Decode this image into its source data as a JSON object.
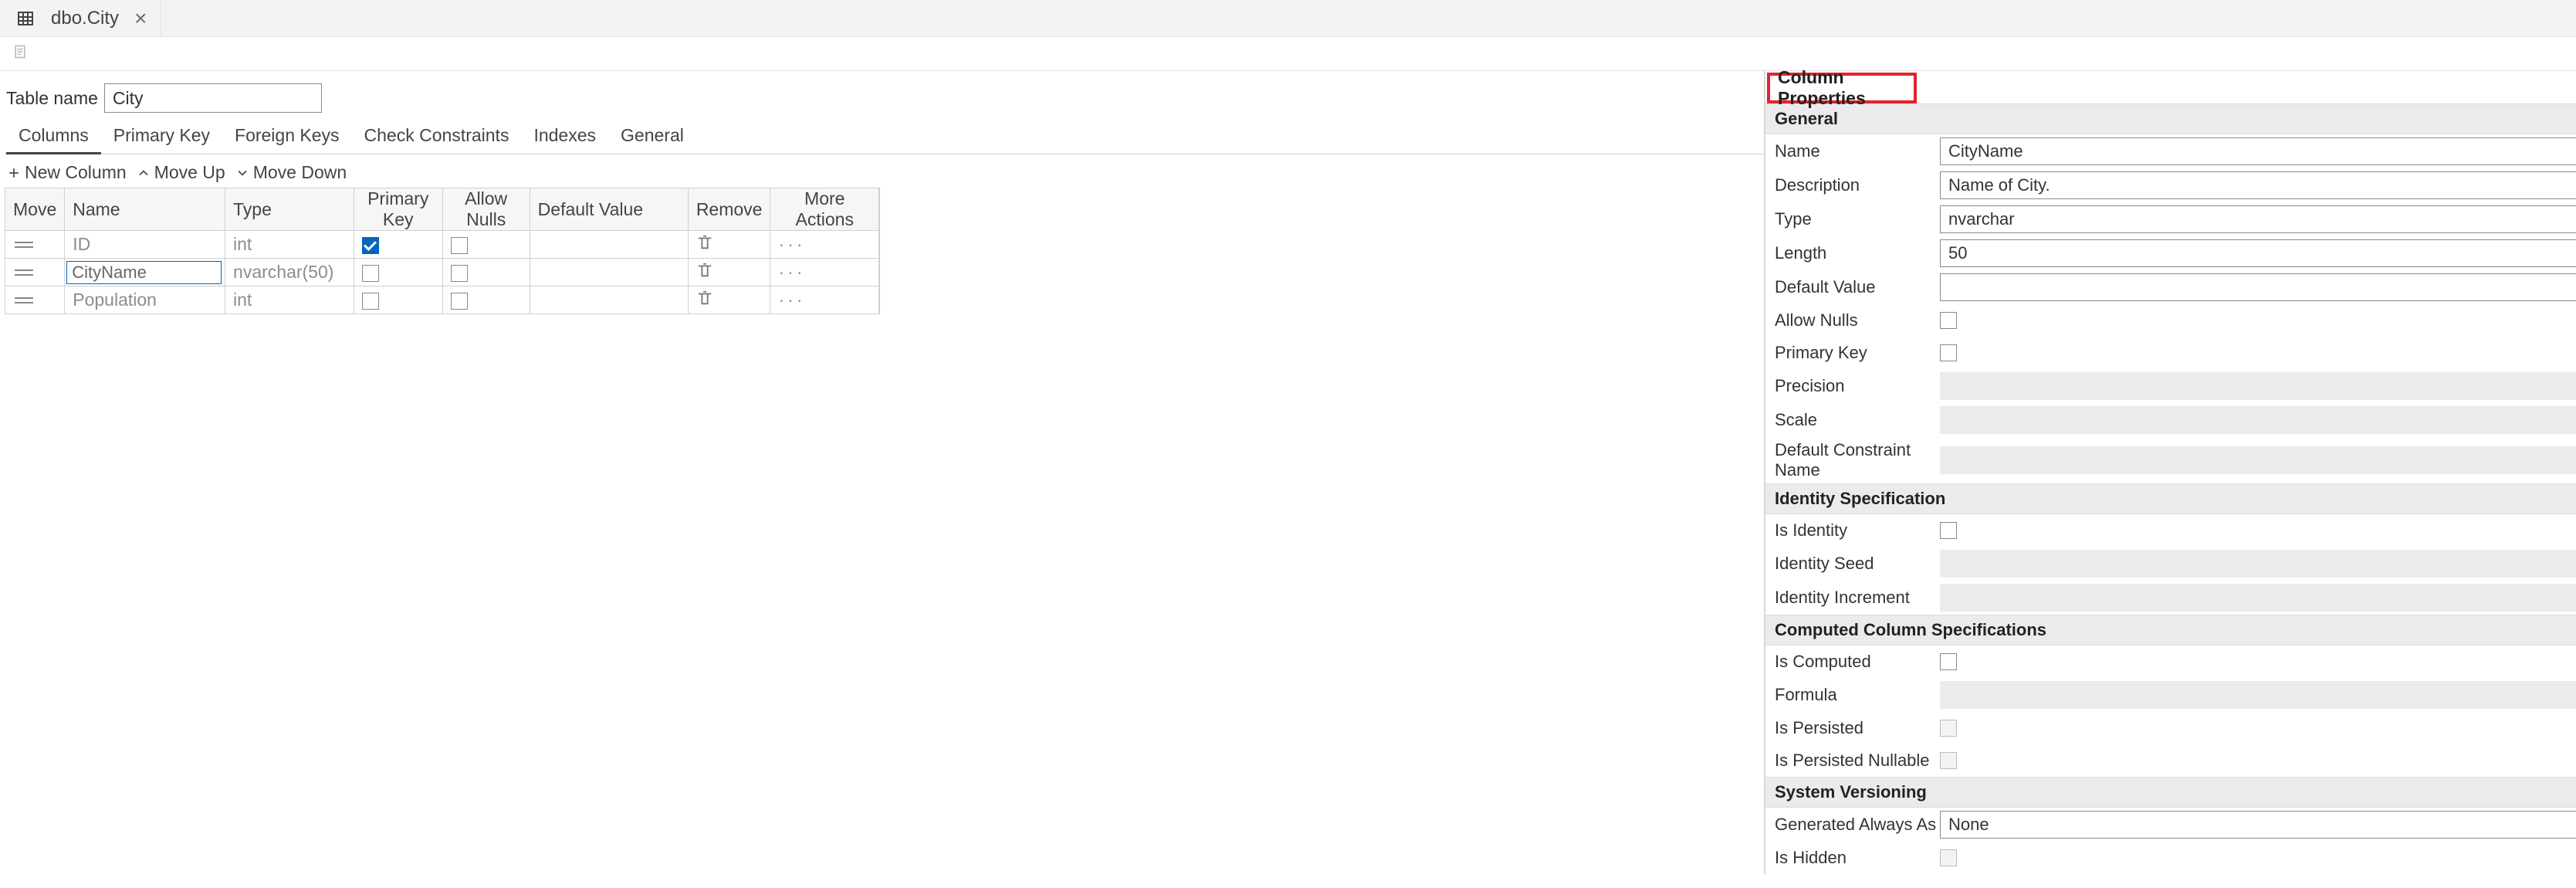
{
  "tab": {
    "title": "dbo.City"
  },
  "table": {
    "name_label": "Table name",
    "name_value": "City"
  },
  "designer_tabs": {
    "columns": "Columns",
    "primary_key": "Primary Key",
    "foreign_keys": "Foreign Keys",
    "check_constraints": "Check Constraints",
    "indexes": "Indexes",
    "general": "General"
  },
  "toolbar": {
    "new_column": "New Column",
    "move_up": "Move Up",
    "move_down": "Move Down"
  },
  "grid": {
    "headers": {
      "move": "Move",
      "name": "Name",
      "type": "Type",
      "pk": "Primary Key",
      "nulls": "Allow Nulls",
      "def": "Default Value",
      "remove": "Remove",
      "more": "More Actions"
    },
    "rows": [
      {
        "name": "ID",
        "type": "int",
        "pk": true,
        "nulls": false
      },
      {
        "name": "CityName",
        "type": "nvarchar(50)",
        "pk": false,
        "nulls": false,
        "editing": true
      },
      {
        "name": "Population",
        "type": "int",
        "pk": false,
        "nulls": false
      }
    ]
  },
  "props": {
    "title": "Column Properties",
    "general": "General",
    "fields": {
      "name_label": "Name",
      "name_value": "CityName",
      "desc_label": "Description",
      "desc_value": "Name of City.",
      "type_label": "Type",
      "type_value": "nvarchar",
      "len_label": "Length",
      "len_value": "50",
      "def_label": "Default Value",
      "def_value": "",
      "nulls_label": "Allow Nulls",
      "pk_label": "Primary Key",
      "precision_label": "Precision",
      "scale_label": "Scale",
      "dcn_label": "Default Constraint Name"
    },
    "identity": {
      "header": "Identity Specification",
      "is_identity": "Is Identity",
      "seed": "Identity Seed",
      "increment": "Identity Increment"
    },
    "computed": {
      "header": "Computed Column Specifications",
      "is_computed": "Is Computed",
      "formula": "Formula",
      "is_persisted": "Is Persisted",
      "is_persisted_nullable": "Is Persisted Nullable"
    },
    "sysver": {
      "header": "System Versioning",
      "gaa_label": "Generated Always As",
      "gaa_value": "None",
      "is_hidden": "Is Hidden"
    }
  }
}
